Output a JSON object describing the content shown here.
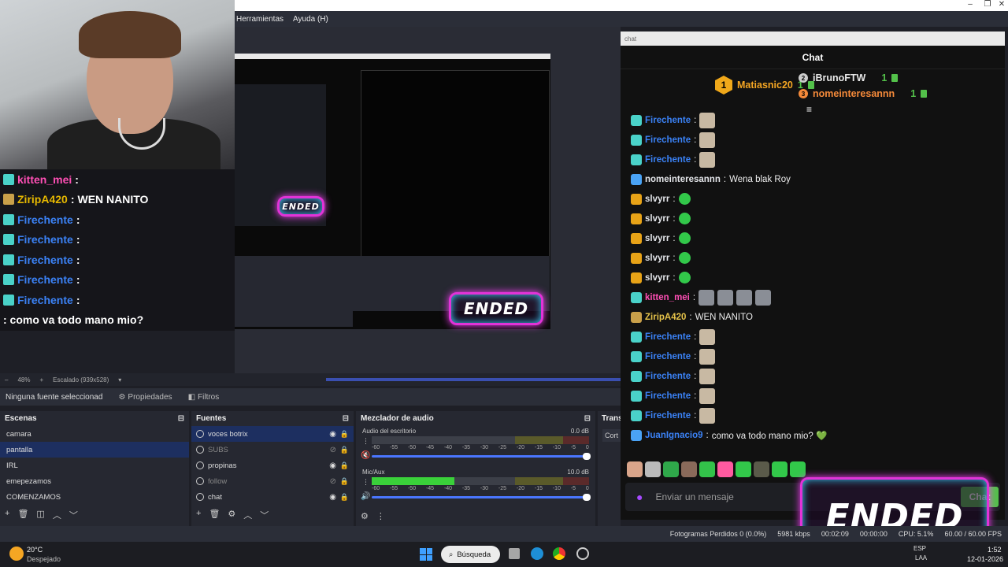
{
  "menu": {
    "herramientas": "Herramientas",
    "ayuda": "Ayuda (H)"
  },
  "window_controls": {
    "minimize": "–",
    "maximize": "❐",
    "close": "✕"
  },
  "overlay_chat": {
    "lines": [
      {
        "name": "kitten_mei",
        "sep": " :",
        "text": "",
        "color": "#ff4fb5",
        "icon_color": "#4ad2c9"
      },
      {
        "name": "ZiripA420",
        "sep": " :",
        "text": " WEN NANITO",
        "color": "#e6b800",
        "icon_color": "#c9a04a"
      },
      {
        "name": "Firechente",
        "sep": " :",
        "text": "",
        "color": "#3b82f6",
        "icon_color": "#4ad2c9"
      },
      {
        "name": "Firechente",
        "sep": " :",
        "text": "",
        "color": "#3b82f6",
        "icon_color": "#4ad2c9"
      },
      {
        "name": "Firechente",
        "sep": " :",
        "text": "",
        "color": "#3b82f6",
        "icon_color": "#4ad2c9"
      },
      {
        "name": "Firechente",
        "sep": " :",
        "text": "",
        "color": "#3b82f6",
        "icon_color": "#4ad2c9"
      },
      {
        "name": "Firechente",
        "sep": " :",
        "text": "",
        "color": "#3b82f6",
        "icon_color": "#4ad2c9"
      }
    ],
    "last_line": ": como va todo mano mio?"
  },
  "zoom": {
    "level": "48%",
    "scale": "Escalado (939x528)"
  },
  "propbar": {
    "no_source": "Ninguna fuente seleccionad",
    "properties": "Propiedades",
    "filters": "Filtros"
  },
  "scenes": {
    "title": "Escenas",
    "items": [
      "camara",
      "pantalla",
      "IRL",
      "emepezamos",
      "COMENZAMOS"
    ],
    "selected": 1
  },
  "sources": {
    "title": "Fuentes",
    "items": [
      {
        "label": "voces botrix",
        "visible": true,
        "dim": false
      },
      {
        "label": "SUBS",
        "visible": false,
        "dim": true
      },
      {
        "label": "propinas",
        "visible": true,
        "dim": false
      },
      {
        "label": "follow",
        "visible": false,
        "dim": true
      },
      {
        "label": "chat",
        "visible": true,
        "dim": false
      }
    ]
  },
  "mixer": {
    "title": "Mezclador de audio",
    "channels": [
      {
        "name": "Audio del escritorio",
        "db": "0.0 dB",
        "level": 0.0,
        "muted": true
      },
      {
        "name": "Mic/Aux",
        "db": "10.0 dB",
        "level": 0.38,
        "muted": false
      }
    ],
    "ticks": [
      "-60",
      "-55",
      "-50",
      "-45",
      "-40",
      "-35",
      "-30",
      "-25",
      "-20",
      "-15",
      "-10",
      "-5",
      "0"
    ]
  },
  "transitions": {
    "title": "Trans",
    "label": "Cort"
  },
  "chat": {
    "tab_title": "chat",
    "header": "Chat",
    "leaders": [
      {
        "rank": "1",
        "name": "Matiasnic20",
        "count": "1",
        "color": "#f5a623"
      },
      {
        "rank": "2",
        "name": "iBrunoFTW",
        "count": "1",
        "color": "#e8e8e8"
      },
      {
        "rank": "3",
        "name": "nomeinteresannn",
        "count": "1",
        "color": "#f58a3a"
      }
    ],
    "messages": [
      {
        "name": "Firechente",
        "sep": ":",
        "text": "",
        "color": "#3b82f6",
        "badge": "#4ad2c9",
        "emote": "img"
      },
      {
        "name": "Firechente",
        "sep": ":",
        "text": "",
        "color": "#3b82f6",
        "badge": "#4ad2c9",
        "emote": "img"
      },
      {
        "name": "Firechente",
        "sep": ":",
        "text": "",
        "color": "#3b82f6",
        "badge": "#4ad2c9",
        "emote": "img"
      },
      {
        "name": "nomeinteresannn",
        "sep": ":",
        "text": " Wena blak Roy",
        "color": "#e5e7eb",
        "badge": "#4aa3f5",
        "emote": ""
      },
      {
        "name": "slvyrr",
        "sep": ":",
        "text": "",
        "color": "#e5e7eb",
        "badge": "#e8a317",
        "emote": "green"
      },
      {
        "name": "slvyrr",
        "sep": ":",
        "text": "",
        "color": "#e5e7eb",
        "badge": "#e8a317",
        "emote": "green"
      },
      {
        "name": "slvyrr",
        "sep": ":",
        "text": "",
        "color": "#e5e7eb",
        "badge": "#e8a317",
        "emote": "green"
      },
      {
        "name": "slvyrr",
        "sep": ":",
        "text": "",
        "color": "#e5e7eb",
        "badge": "#e8a317",
        "emote": "green"
      },
      {
        "name": "slvyrr",
        "sep": ":",
        "text": "",
        "color": "#e5e7eb",
        "badge": "#e8a317",
        "emote": "green"
      },
      {
        "name": "kitten_mei",
        "sep": ":",
        "text": "",
        "color": "#ff4fb5",
        "badge": "#4ad2c9",
        "emote": "multi"
      },
      {
        "name": "ZiripA420",
        "sep": ":",
        "text": " WEN NANITO",
        "color": "#e6c34a",
        "badge": "#c9a04a",
        "emote": ""
      },
      {
        "name": "Firechente",
        "sep": ":",
        "text": "",
        "color": "#3b82f6",
        "badge": "#4ad2c9",
        "emote": "img"
      },
      {
        "name": "Firechente",
        "sep": ":",
        "text": "",
        "color": "#3b82f6",
        "badge": "#4ad2c9",
        "emote": "img"
      },
      {
        "name": "Firechente",
        "sep": ":",
        "text": "",
        "color": "#3b82f6",
        "badge": "#4ad2c9",
        "emote": "img"
      },
      {
        "name": "Firechente",
        "sep": ":",
        "text": "",
        "color": "#3b82f6",
        "badge": "#4ad2c9",
        "emote": "img"
      },
      {
        "name": "Firechente",
        "sep": ":",
        "text": "",
        "color": "#3b82f6",
        "badge": "#4ad2c9",
        "emote": "img"
      },
      {
        "name": "JuanIgnacio9",
        "sep": ":",
        "text": " como va todo mano mio? 💚",
        "color": "#3b82f6",
        "badge": "#4aa3f5",
        "emote": ""
      }
    ],
    "input_placeholder": "Enviar un mensaje",
    "send_label": "Chat"
  },
  "status": {
    "frames_dropped": "Fotogramas Perdidos 0 (0.0%)",
    "kbps": "5981 kbps",
    "time_rec": "00:02:09",
    "time2": "00:00:00",
    "cpu": "CPU: 5.1%",
    "fps": "60.00 / 60.00 FPS"
  },
  "ended_logo": {
    "text": "ENDED"
  },
  "taskbar": {
    "weather_temp": "20°C",
    "weather_desc": "Despejado",
    "search_label": "Búsqueda",
    "lang": "ESP",
    "lang2": "LAA",
    "time": "1:52",
    "date": "12-01-2026"
  }
}
